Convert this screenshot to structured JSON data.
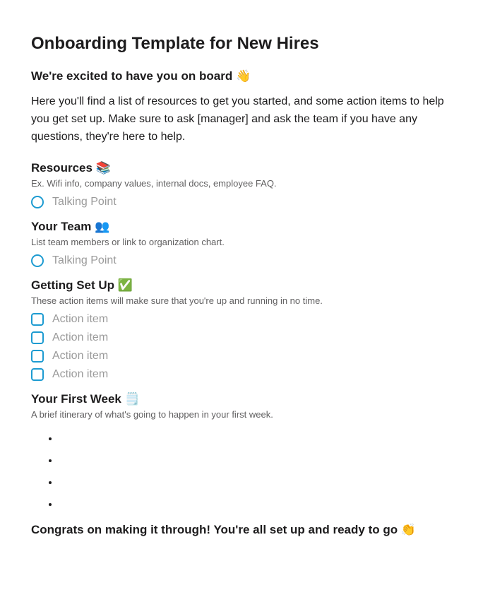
{
  "title": "Onboarding Template for New Hires",
  "welcome": "We're excited to have you on board 👋",
  "intro": "Here you'll find a list of resources to get you started, and some action items to help you get set up. Make sure to ask [manager] and ask the team if you have any questions, they're here to help.",
  "resources": {
    "heading": "Resources 📚",
    "sub": "Ex. Wifi info, company values, internal docs, employee FAQ.",
    "talking_point": "Talking Point"
  },
  "team": {
    "heading": "Your Team 👥",
    "sub": "List team members or link to organization chart.",
    "talking_point": "Talking Point"
  },
  "setup": {
    "heading": "Getting Set Up ✅",
    "sub": "These action items will make sure that you're up and running in no time.",
    "items": [
      "Action item",
      "Action item",
      "Action item",
      "Action item"
    ]
  },
  "firstweek": {
    "heading": "Your First Week 🗒️",
    "sub": "A brief itinerary of what's going to happen in your first week.",
    "bullets": [
      "",
      "",
      "",
      ""
    ]
  },
  "congrats": "Congrats on making it through! You're all set up and ready to go 👏"
}
